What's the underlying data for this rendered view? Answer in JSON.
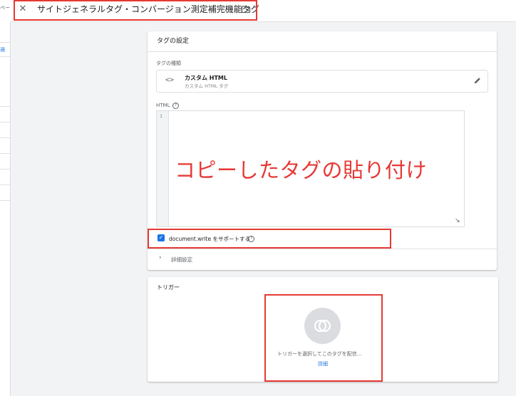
{
  "header": {
    "close_icon": "close-icon",
    "title": "サイトジェネラルタグ・コンバージョン測定補完機能タグ",
    "folder_icon": "folder-icon"
  },
  "left_panel": {
    "fragments": [
      "ペー",
      "適"
    ]
  },
  "tag_config": {
    "heading": "タグの設定",
    "type_label": "タグの種類",
    "type_name": "カスタム HTML",
    "type_subtitle": "カスタム HTML タグ",
    "html_label": "HTML",
    "line_number": "1",
    "annotation": "コピーしたタグの貼り付け",
    "support_document_write_label": "document.write をサポートする",
    "support_document_write_checked": true,
    "advanced_label": "詳細設定"
  },
  "trigger": {
    "heading": "トリガー",
    "prompt": "トリガーを選択してこのタグを配信...",
    "link": "詳細"
  },
  "colors": {
    "highlight": "#e53935",
    "accent": "#1a73e8",
    "background": "#f1f3f4"
  }
}
